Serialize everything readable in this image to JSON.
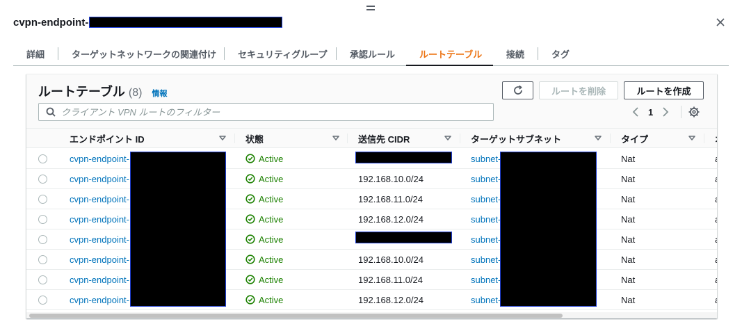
{
  "dialog": {
    "title_prefix": "cvpn-endpoint-"
  },
  "tabs": [
    {
      "label": "詳細"
    },
    {
      "label": "ターゲットネットワークの関連付け"
    },
    {
      "label": "セキュリティグループ"
    },
    {
      "label": "承認ルール"
    },
    {
      "label": "ルートテーブル",
      "active": true
    },
    {
      "label": "接続"
    },
    {
      "label": "タグ"
    }
  ],
  "container": {
    "title": "ルートテーブル",
    "count": "(8)",
    "info_link": "情報",
    "delete_button": "ルートを削除",
    "create_button": "ルートを作成"
  },
  "search": {
    "placeholder": "クライアント VPN ルートのフィルター"
  },
  "pagination": {
    "current_page": "1"
  },
  "table": {
    "columns": [
      "エンドポイント ID",
      "状態",
      "送信先 CIDR",
      "ターゲットサブネット",
      "タイプ",
      "オ"
    ],
    "rows": [
      {
        "endpoint": "cvpn-endpoint-",
        "status": "Active",
        "cidr": "",
        "subnet": "subnet-",
        "type": "Nat",
        "origin": "a"
      },
      {
        "endpoint": "cvpn-endpoint-",
        "status": "Active",
        "cidr": "192.168.10.0/24",
        "subnet": "subnet-",
        "type": "Nat",
        "origin": "a"
      },
      {
        "endpoint": "cvpn-endpoint-",
        "status": "Active",
        "cidr": "192.168.11.0/24",
        "subnet": "subnet-",
        "type": "Nat",
        "origin": "a"
      },
      {
        "endpoint": "cvpn-endpoint-",
        "status": "Active",
        "cidr": "192.168.12.0/24",
        "subnet": "subnet-",
        "type": "Nat",
        "origin": "a"
      },
      {
        "endpoint": "cvpn-endpoint-",
        "status": "Active",
        "cidr": "",
        "subnet": "subnet-",
        "type": "Nat",
        "origin": "a"
      },
      {
        "endpoint": "cvpn-endpoint-",
        "status": "Active",
        "cidr": "192.168.10.0/24",
        "subnet": "subnet-",
        "type": "Nat",
        "origin": "a"
      },
      {
        "endpoint": "cvpn-endpoint-",
        "status": "Active",
        "cidr": "192.168.11.0/24",
        "subnet": "subnet-",
        "type": "Nat",
        "origin": "a"
      },
      {
        "endpoint": "cvpn-endpoint-",
        "status": "Active",
        "cidr": "192.168.12.0/24",
        "subnet": "subnet-",
        "type": "Nat",
        "origin": "a"
      }
    ]
  },
  "colors": {
    "link": "#0073bb",
    "active_status": "#1d8102",
    "active_tab": "#ec7211",
    "redaction": "#000000",
    "redaction_border": "#1f3fd6"
  },
  "icons": {
    "close": "close-icon",
    "refresh": "refresh-icon",
    "search": "search-icon",
    "prev": "chevron-left-icon",
    "next": "chevron-right-icon",
    "settings": "gear-icon",
    "status": "check-circle-icon",
    "sort": "caret-down-icon"
  }
}
